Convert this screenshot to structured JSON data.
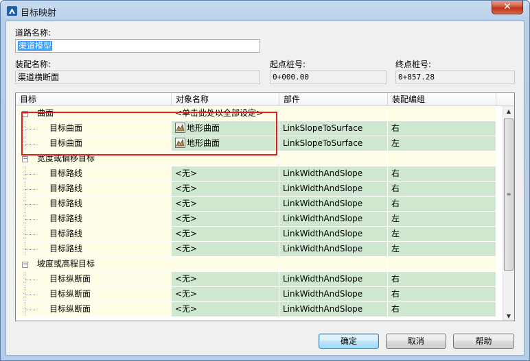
{
  "window": {
    "title": "目标映射"
  },
  "form": {
    "road_name_label": "道路名称:",
    "road_name_value": "渠道模型",
    "assembly_label": "装配名称:",
    "assembly_value": "渠道横断面",
    "start_station_label": "起点桩号:",
    "start_station_value": "0+000.00",
    "end_station_label": "终点桩号:",
    "end_station_value": "0+857.28"
  },
  "table": {
    "columns": [
      "目标",
      "对象名称",
      "部件",
      "装配编组"
    ],
    "rows": [
      {
        "kind": "category",
        "target": "曲面",
        "object": "<单击此处以全部设定>",
        "part": "",
        "group": ""
      },
      {
        "kind": "item",
        "target": "目标曲面",
        "object": "地形曲面",
        "part": "LinkSlopeToSurface",
        "group": "右",
        "icon": "surface-icon"
      },
      {
        "kind": "item",
        "target": "目标曲面",
        "object": "地形曲面",
        "part": "LinkSlopeToSurface",
        "group": "左",
        "icon": "surface-icon"
      },
      {
        "kind": "category",
        "target": "宽度或偏移目标",
        "object": "",
        "part": "",
        "group": ""
      },
      {
        "kind": "item",
        "target": "目标路线",
        "object": "<无>",
        "part": "LinkWidthAndSlope",
        "group": "右"
      },
      {
        "kind": "item",
        "target": "目标路线",
        "object": "<无>",
        "part": "LinkWidthAndSlope",
        "group": "右"
      },
      {
        "kind": "item",
        "target": "目标路线",
        "object": "<无>",
        "part": "LinkWidthAndSlope",
        "group": "右"
      },
      {
        "kind": "item",
        "target": "目标路线",
        "object": "<无>",
        "part": "LinkWidthAndSlope",
        "group": "左"
      },
      {
        "kind": "item",
        "target": "目标路线",
        "object": "<无>",
        "part": "LinkWidthAndSlope",
        "group": "左"
      },
      {
        "kind": "item",
        "target": "目标路线",
        "object": "<无>",
        "part": "LinkWidthAndSlope",
        "group": "左"
      },
      {
        "kind": "category",
        "target": "坡度或高程目标",
        "object": "",
        "part": "",
        "group": ""
      },
      {
        "kind": "item",
        "target": "目标纵断面",
        "object": "<无>",
        "part": "LinkWidthAndSlope",
        "group": "右"
      },
      {
        "kind": "item",
        "target": "目标纵断面",
        "object": "<无>",
        "part": "LinkWidthAndSlope",
        "group": "右"
      },
      {
        "kind": "item",
        "target": "目标纵断面",
        "object": "<无>",
        "part": "LinkWidthAndSlope",
        "group": "右"
      }
    ]
  },
  "buttons": {
    "ok": "确定",
    "cancel": "取消",
    "help": "帮助"
  },
  "colors": {
    "highlight_box": "#e01e1e",
    "mapped_cell": "#cfe8cf",
    "target_cell": "#fffde5"
  }
}
